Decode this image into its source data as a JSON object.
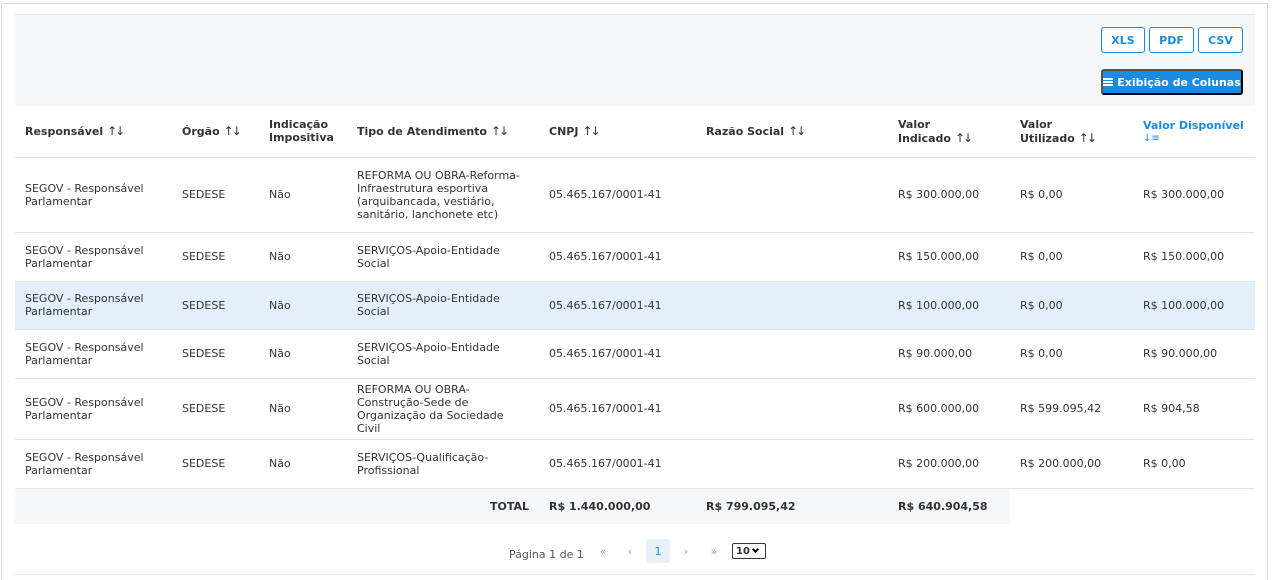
{
  "toolbar": {
    "xls": "XLS",
    "pdf": "PDF",
    "csv": "CSV",
    "columns": "Exibição de Colunas"
  },
  "columns": [
    "Responsável",
    "Órgão",
    "Indicação Impositiva",
    "Tipo de Atendimento",
    "CNPJ",
    "Razão Social",
    "Valor Indicado",
    "Valor Utilizado",
    "Valor Disponível"
  ],
  "rows": [
    [
      "SEGOV - Responsável Parlamentar",
      "SEDESE",
      "Não",
      "REFORMA OU OBRA-Reforma-Infraestrutura esportiva (arquibancada, vestiário, sanitário, lanchonete etc)",
      "05.465.167/0001-41",
      "",
      "R$ 300.000,00",
      "R$ 0,00",
      "R$ 300.000,00"
    ],
    [
      "SEGOV - Responsável Parlamentar",
      "SEDESE",
      "Não",
      "SERVIÇOS-Apoio-Entidade Social",
      "05.465.167/0001-41",
      "",
      "R$ 150.000,00",
      "R$ 0,00",
      "R$ 150.000,00"
    ],
    [
      "SEGOV - Responsável Parlamentar",
      "SEDESE",
      "Não",
      "SERVIÇOS-Apoio-Entidade Social",
      "05.465.167/0001-41",
      "",
      "R$ 100.000,00",
      "R$ 0,00",
      "R$ 100.000,00"
    ],
    [
      "SEGOV - Responsável Parlamentar",
      "SEDESE",
      "Não",
      "SERVIÇOS-Apoio-Entidade Social",
      "05.465.167/0001-41",
      "",
      "R$ 90.000,00",
      "R$ 0,00",
      "R$ 90.000,00"
    ],
    [
      "SEGOV - Responsável Parlamentar",
      "SEDESE",
      "Não",
      "REFORMA OU OBRA-Construção-Sede de Organização da Sociedade Civil",
      "05.465.167/0001-41",
      "",
      "R$ 600.000,00",
      "R$ 599.095,42",
      "R$ 904,58"
    ],
    [
      "SEGOV - Responsável Parlamentar",
      "SEDESE",
      "Não",
      "SERVIÇOS-Qualificação-Profissional",
      "05.465.167/0001-41",
      "",
      "R$ 200.000,00",
      "R$ 200.000,00",
      "R$ 0,00"
    ]
  ],
  "totals": {
    "label": "TOTAL",
    "indicado": "R$ 1.440.000,00",
    "utilizado": "R$ 799.095,42",
    "disponivel": "R$ 640.904,58"
  },
  "pagination": {
    "info": "Página 1 de 1",
    "first": "«",
    "prev": "‹",
    "current": "1",
    "next": "›",
    "last": "»",
    "page_size": "10"
  },
  "sort_icons": {
    "unsorted": "↑↓",
    "descending": "↓≡"
  },
  "highlight_row": 2,
  "accent_color": "#1a8be3"
}
